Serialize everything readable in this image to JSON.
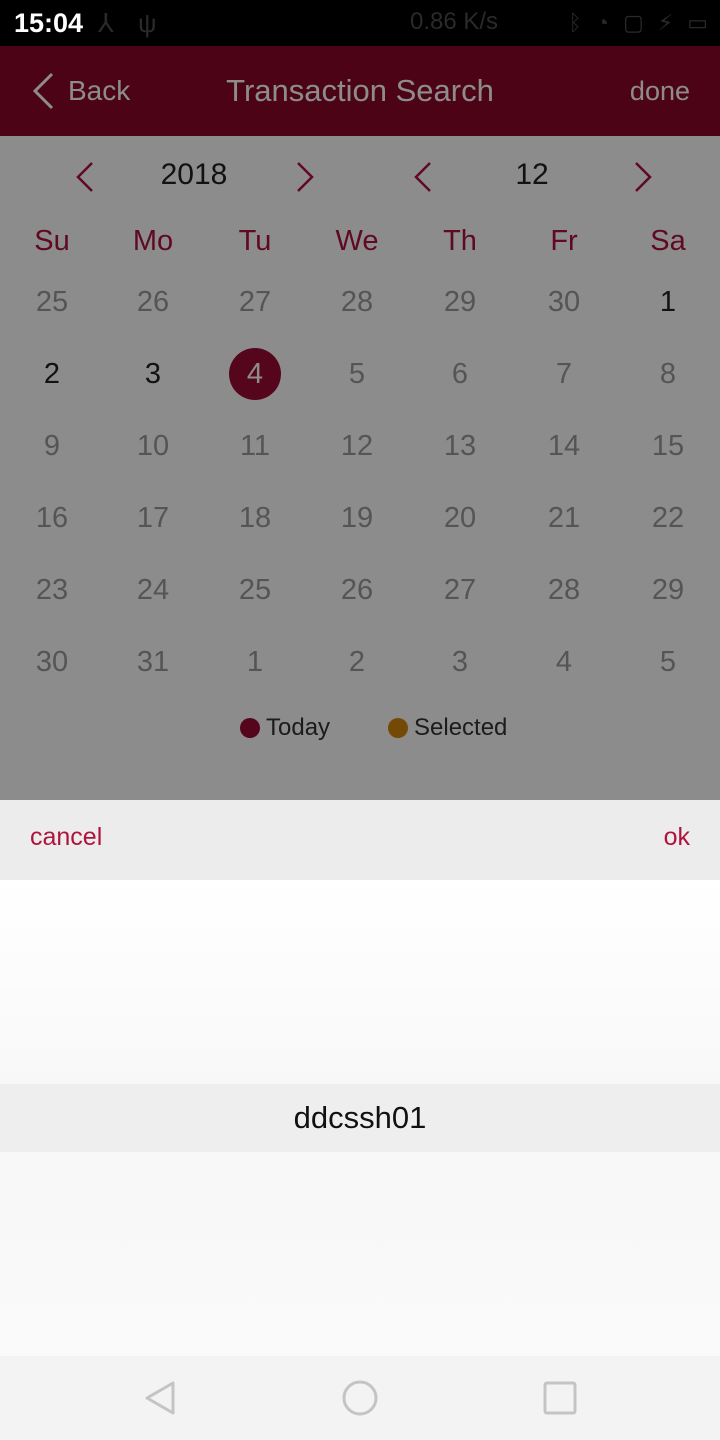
{
  "status_bar": {
    "time": "15:04",
    "network_speed": "0.86 K/s"
  },
  "app_bar": {
    "back_label": "Back",
    "title": "Transaction Search",
    "done_label": "done"
  },
  "calendar": {
    "year": "2018",
    "month": "12",
    "weekdays": [
      "Su",
      "Mo",
      "Tu",
      "We",
      "Th",
      "Fr",
      "Sa"
    ],
    "weeks": [
      [
        "25",
        "26",
        "27",
        "28",
        "29",
        "30",
        "1"
      ],
      [
        "2",
        "3",
        "4",
        "5",
        "6",
        "7",
        "8"
      ],
      [
        "9",
        "10",
        "11",
        "12",
        "13",
        "14",
        "15"
      ],
      [
        "16",
        "17",
        "18",
        "19",
        "20",
        "21",
        "22"
      ],
      [
        "23",
        "24",
        "25",
        "26",
        "27",
        "28",
        "29"
      ],
      [
        "30",
        "31",
        "1",
        "2",
        "3",
        "4",
        "5"
      ]
    ],
    "today": "4",
    "legend": {
      "today_label": "Today",
      "selected_label": "Selected",
      "today_color": "#9b0a33",
      "selected_color": "#d4860b"
    }
  },
  "picker": {
    "cancel_label": "cancel",
    "ok_label": "ok",
    "selected_value": "ddcssh01"
  },
  "colors": {
    "accent": "#8d0628",
    "text_accent": "#b0123e"
  }
}
